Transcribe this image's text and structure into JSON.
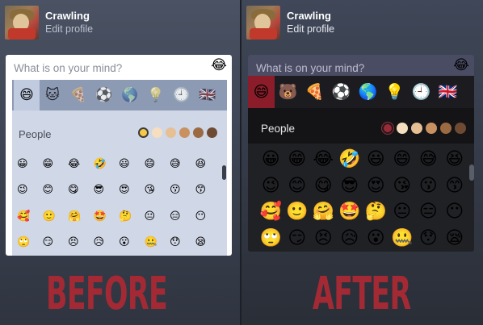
{
  "before": {
    "user": {
      "name": "Crawling",
      "edit_label": "Edit profile"
    },
    "composer": {
      "placeholder": "What is on your mind?",
      "emoji_button": "😂",
      "categories": [
        {
          "glyph": "😄",
          "icon": "smiley-category-icon",
          "active": true
        },
        {
          "glyph": "🐱",
          "icon": "animals-category-icon",
          "active": false
        },
        {
          "glyph": "🍕",
          "icon": "food-category-icon",
          "active": false
        },
        {
          "glyph": "⚽",
          "icon": "activity-category-icon",
          "active": false
        },
        {
          "glyph": "🌎",
          "icon": "travel-category-icon",
          "active": false
        },
        {
          "glyph": "💡",
          "icon": "objects-category-icon",
          "active": false
        },
        {
          "glyph": "🕘",
          "icon": "recent-category-icon",
          "active": false
        },
        {
          "glyph": "🇬🇧",
          "icon": "flags-category-icon",
          "active": false
        }
      ],
      "section_label": "People",
      "skin_tones": [
        "#f7c948",
        "#f5dfc0",
        "#e7bf95",
        "#c9915f",
        "#9b6a43",
        "#6f4a33"
      ],
      "emojis": [
        "😀",
        "😁",
        "😂",
        "🤣",
        "😃",
        "😄",
        "😅",
        "😆",
        "😉",
        "😊",
        "😋",
        "😎",
        "😍",
        "😘",
        "😗",
        "😙",
        "🥰",
        "🙂",
        "🤗",
        "🤩",
        "🤔",
        "😐",
        "😑",
        "😶",
        "🙄",
        "😏",
        "😣",
        "😥",
        "😮",
        "🤐",
        "😯",
        "😪"
      ]
    }
  },
  "after": {
    "user": {
      "name": "Crawling",
      "edit_label": "Edit profile"
    },
    "composer": {
      "placeholder": "What is on your mind?",
      "emoji_button": "😂",
      "categories": [
        {
          "glyph": "😄",
          "icon": "smiley-category-icon",
          "active": true
        },
        {
          "glyph": "🐻",
          "icon": "animals-category-icon",
          "active": false
        },
        {
          "glyph": "🍕",
          "icon": "food-category-icon",
          "active": false
        },
        {
          "glyph": "⚽",
          "icon": "activity-category-icon",
          "active": false
        },
        {
          "glyph": "🌎",
          "icon": "travel-category-icon",
          "active": false
        },
        {
          "glyph": "💡",
          "icon": "objects-category-icon",
          "active": false
        },
        {
          "glyph": "🕘",
          "icon": "recent-category-icon",
          "active": false
        },
        {
          "glyph": "🇬🇧",
          "icon": "flags-category-icon",
          "active": false
        }
      ],
      "section_label": "People",
      "skin_tones": [
        "#9a2a36",
        "#f5dfc0",
        "#e7bf95",
        "#c9915f",
        "#9b6a43",
        "#6f4a33"
      ],
      "emojis": [
        "😀",
        "😁",
        "😂",
        "🤣",
        "😃",
        "😄",
        "😅",
        "😆",
        "😉",
        "😊",
        "😋",
        "😎",
        "😍",
        "😘",
        "😗",
        "😙",
        "🥰",
        "🙂",
        "🤗",
        "🤩",
        "🤔",
        "😐",
        "😑",
        "😶",
        "🙄",
        "😏",
        "😣",
        "😥",
        "😮",
        "🤐",
        "😯",
        "😪"
      ]
    }
  },
  "captions": {
    "before": "BEFORE",
    "after": "AFTER"
  }
}
